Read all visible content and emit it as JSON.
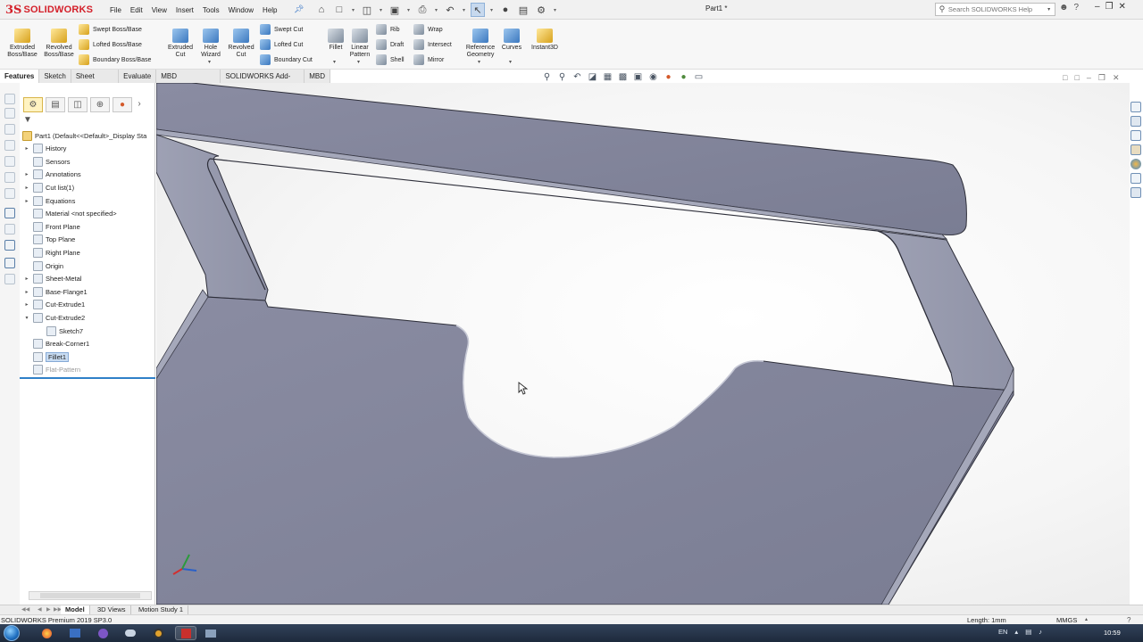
{
  "app": {
    "logo_ds": "3S",
    "logo_name": "SOLIDWORKS",
    "document_title": "Part1 *"
  },
  "menu": [
    "File",
    "Edit",
    "View",
    "Insert",
    "Tools",
    "Window",
    "Help"
  ],
  "search": {
    "placeholder": "Search SOLIDWORKS Help"
  },
  "ribbon": {
    "extruded_boss": "Extruded Boss/Base",
    "revolved_boss": "Revolved Boss/Base",
    "swept_boss": "Swept Boss/Base",
    "lofted_boss": "Lofted Boss/Base",
    "boundary_boss": "Boundary Boss/Base",
    "extruded_cut": "Extruded Cut",
    "hole_wizard": "Hole Wizard",
    "revolved_cut": "Revolved Cut",
    "swept_cut": "Swept Cut",
    "lofted_cut": "Lofted Cut",
    "boundary_cut": "Boundary Cut",
    "fillet": "Fillet",
    "linear_pattern": "Linear Pattern",
    "rib": "Rib",
    "draft": "Draft",
    "shell": "Shell",
    "wrap": "Wrap",
    "intersect": "Intersect",
    "mirror": "Mirror",
    "reference_geometry": "Reference Geometry",
    "curves": "Curves",
    "instant3d": "Instant3D"
  },
  "command_tabs": [
    "Features",
    "Sketch",
    "Sheet Metal",
    "Evaluate",
    "MBD Dimensions",
    "SOLIDWORKS Add-Ins",
    "MBD"
  ],
  "active_command_tab": "Features",
  "feature_tree": {
    "root": "Part1  (Default<<Default>_Display Sta",
    "items": [
      {
        "label": "History",
        "expandable": true
      },
      {
        "label": "Sensors",
        "expandable": false
      },
      {
        "label": "Annotations",
        "expandable": true
      },
      {
        "label": "Cut list(1)",
        "expandable": true
      },
      {
        "label": "Equations",
        "expandable": true
      },
      {
        "label": "Material <not specified>",
        "expandable": false
      },
      {
        "label": "Front Plane",
        "expandable": false
      },
      {
        "label": "Top Plane",
        "expandable": false
      },
      {
        "label": "Right Plane",
        "expandable": false
      },
      {
        "label": "Origin",
        "expandable": false
      },
      {
        "label": "Sheet-Metal",
        "expandable": true
      },
      {
        "label": "Base-Flange1",
        "expandable": true
      },
      {
        "label": "Cut-Extrude1",
        "expandable": true
      },
      {
        "label": "Cut-Extrude2",
        "expandable": true,
        "expanded": true
      },
      {
        "label": "Sketch7",
        "child": true
      },
      {
        "label": "Break-Corner1",
        "expandable": false
      },
      {
        "label": "Fillet1",
        "selected": true
      },
      {
        "label": "Flat-Pattern",
        "suppressed": true
      }
    ]
  },
  "bottom_tabs": [
    "Model",
    "3D Views",
    "Motion Study 1"
  ],
  "active_bottom_tab": "Model",
  "status_bar": {
    "product": "SOLIDWORKS Premium 2019 SP3.0",
    "length": "Length: 1mm",
    "units": "MMGS"
  },
  "taskbar": {
    "language": "EN",
    "time": "10:59"
  },
  "colors": {
    "part_face": "#7b7e95",
    "part_face_light": "#9a9db0",
    "part_edge": "#2e2f3a",
    "brand_red": "#d4202a",
    "selection_blue": "#c8dcf2",
    "rollback_bar": "#2f80c8"
  }
}
